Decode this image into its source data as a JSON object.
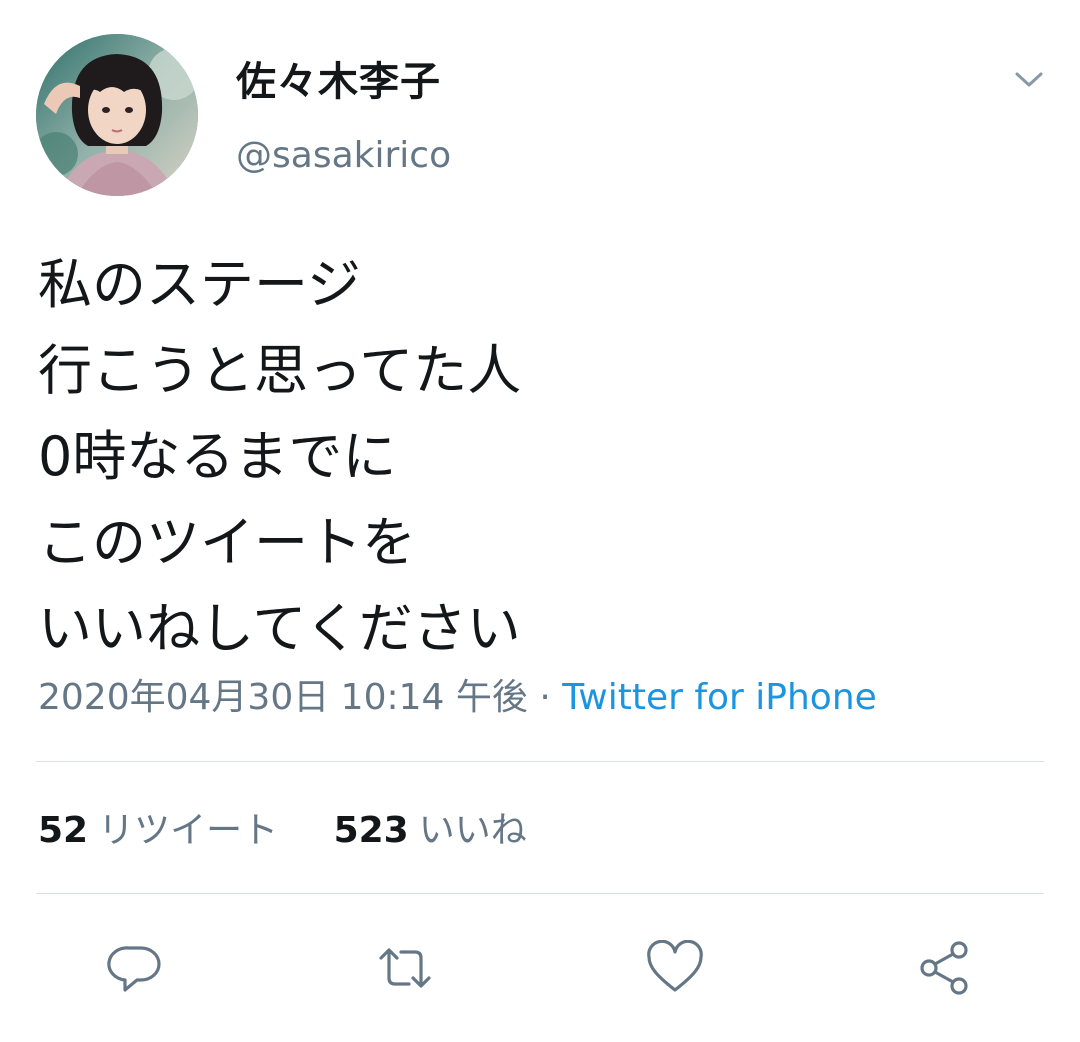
{
  "user": {
    "display_name": "佐々木李子",
    "handle": "@sasakirico"
  },
  "tweet": {
    "lines": [
      "私のステージ",
      "行こうと思ってた人",
      "0時なるまでに",
      "このツイートを",
      "いいねしてください"
    ],
    "timestamp": "2020年04月30日 10:14 午後",
    "separator": "·",
    "source": "Twitter for iPhone"
  },
  "stats": {
    "retweets_count": "52",
    "retweets_label": "リツイート",
    "likes_count": "523",
    "likes_label": "いいね"
  },
  "icons": {
    "caret": "chevron-down-icon",
    "reply": "reply-icon",
    "retweet": "retweet-icon",
    "like": "heart-icon",
    "share": "share-icon"
  },
  "colors": {
    "text": "#14171a",
    "secondary": "#657786",
    "link": "#1b95e0",
    "divider": "#dbe1e6"
  }
}
